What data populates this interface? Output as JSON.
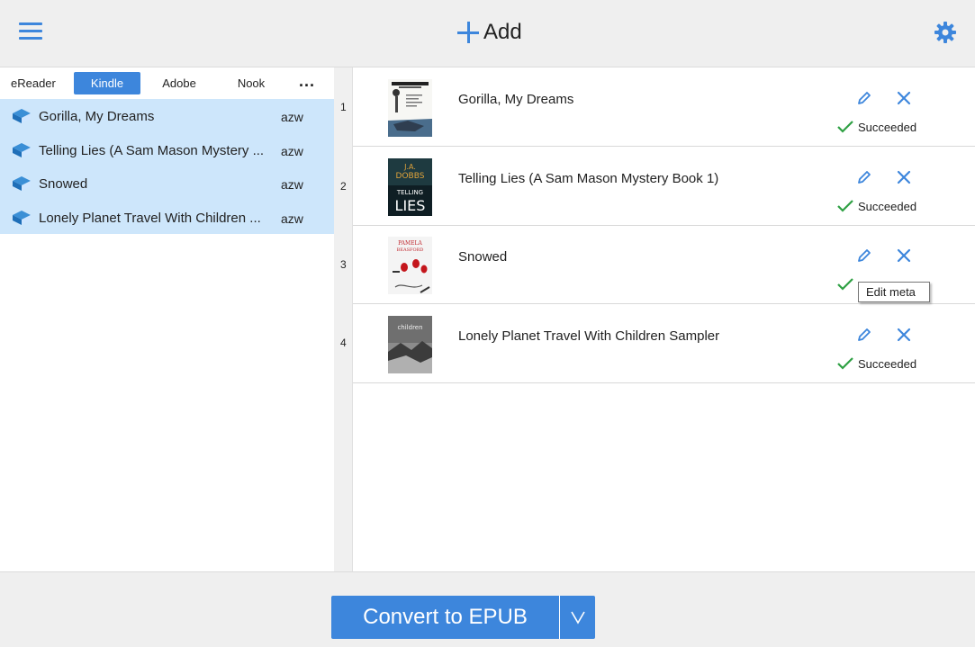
{
  "topbar": {
    "add_label": "Add",
    "accent": "#3d86dc"
  },
  "tabs": [
    {
      "label": "eReader",
      "active": false
    },
    {
      "label": "Kindle",
      "active": true
    },
    {
      "label": "Adobe",
      "active": false
    },
    {
      "label": "Nook",
      "active": false
    }
  ],
  "more_label": "...",
  "files": [
    {
      "title": "Gorilla, My Dreams",
      "ext": "azw"
    },
    {
      "title": "Telling Lies (A Sam Mason Mystery ...",
      "ext": "azw"
    },
    {
      "title": "Snowed",
      "ext": "azw"
    },
    {
      "title": "Lonely Planet Travel With Children ...",
      "ext": "azw"
    }
  ],
  "books": [
    {
      "index": "1",
      "title": "Gorilla, My Dreams",
      "status": "Succeeded",
      "cover": "gorilla-cover"
    },
    {
      "index": "2",
      "title": "Telling Lies (A Sam Mason Mystery Book 1)",
      "status": "Succeeded",
      "cover": "telling-lies-cover",
      "cover_text": [
        "J.A.",
        "DOBBS",
        "TELLING",
        "LIES"
      ]
    },
    {
      "index": "3",
      "title": "Snowed",
      "status": "",
      "cover": "snowed-cover",
      "cover_text": [
        "PAMELA",
        "BEASFORD"
      ]
    },
    {
      "index": "4",
      "title": "Lonely Planet Travel With Children Sampler",
      "status": "Succeeded",
      "cover": "lonely-planet-cover",
      "cover_text": [
        "children"
      ]
    }
  ],
  "tooltip": "Edit meta",
  "convert": {
    "label": "Convert to EPUB"
  },
  "colors": {
    "accent": "#3d86dc",
    "selected_row": "#cde6fb",
    "success": "#2ea043"
  }
}
